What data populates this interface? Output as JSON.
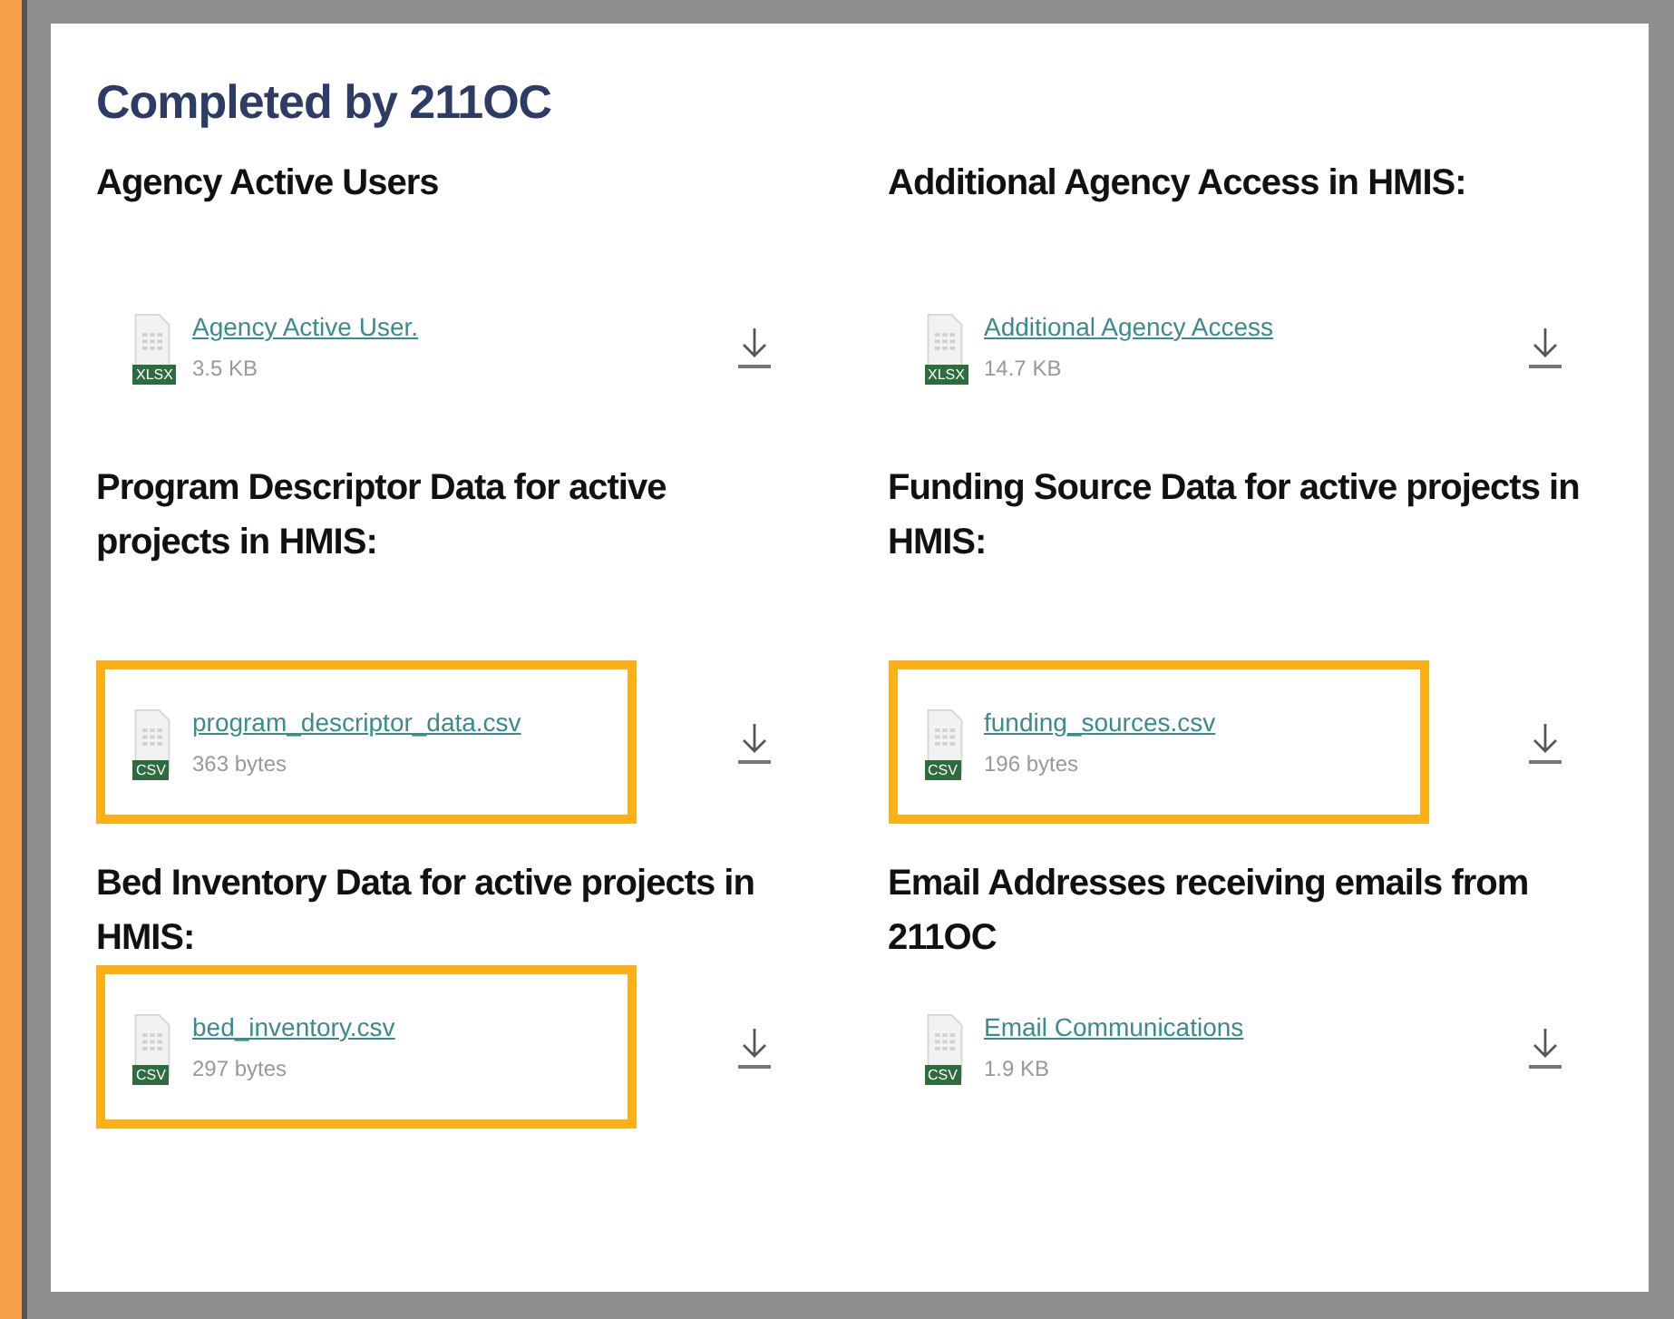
{
  "title": "Completed by 211OC",
  "sections": [
    {
      "heading": "Agency Active Users",
      "file": {
        "name": "Agency Active User.",
        "type": "XLSX",
        "size": "3.5 KB",
        "highlighted": false
      }
    },
    {
      "heading": "Additional Agency Access in HMIS:",
      "file": {
        "name": "Additional Agency Access ",
        "type": "XLSX",
        "size": "14.7 KB",
        "highlighted": false
      }
    },
    {
      "heading": "Program Descriptor Data for active projects in HMIS:",
      "file": {
        "name": "program_descriptor_data.csv",
        "type": "CSV",
        "size": "363 bytes",
        "highlighted": true
      }
    },
    {
      "heading": "Funding Source Data for active projects in HMIS:",
      "file": {
        "name": "funding_sources.csv",
        "type": "CSV",
        "size": "196 bytes",
        "highlighted": true
      }
    },
    {
      "heading": "Bed Inventory Data for active projects in HMIS:",
      "file": {
        "name": "bed_inventory.csv",
        "type": "CSV",
        "size": "297 bytes",
        "highlighted": true
      }
    },
    {
      "heading": "Email Addresses receiving emails from 211OC",
      "file": {
        "name": "Email Communications ",
        "type": "CSV",
        "size": "1.9 KB",
        "highlighted": false
      }
    }
  ]
}
